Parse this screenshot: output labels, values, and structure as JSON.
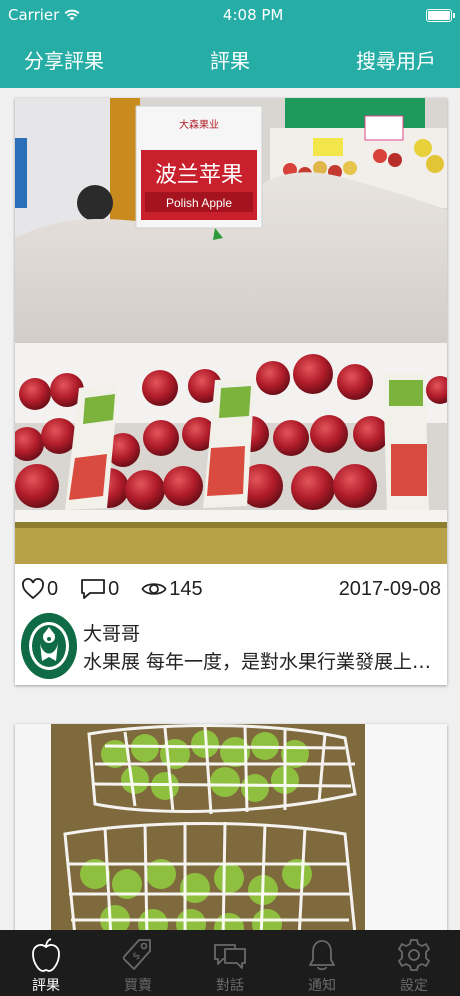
{
  "status_bar": {
    "carrier": "Carrier",
    "time": "4:08 PM"
  },
  "nav": {
    "left": "分享評果",
    "title": "評果",
    "right": "搜尋用戶"
  },
  "posts": [
    {
      "photo_icon": "apple-display-photo",
      "sign": {
        "title": "波兰苹果",
        "subtitle": "Polish Apple",
        "brand": "大森果业"
      },
      "likes": "0",
      "comments": "0",
      "views": "145",
      "date": "2017-09-08",
      "author": "大哥哥",
      "text": "水果展 每年一度，是對水果行業發展上…",
      "avatar_icon": "starbucks-logo-avatar"
    },
    {
      "photo_icon": "green-grapes-box-photo"
    }
  ],
  "tabs": [
    {
      "label": "評果",
      "icon": "apple-icon",
      "active": true
    },
    {
      "label": "買賣",
      "icon": "price-tag-icon",
      "active": false
    },
    {
      "label": "對話",
      "icon": "chat-icon",
      "active": false
    },
    {
      "label": "通知",
      "icon": "bell-icon",
      "active": false
    },
    {
      "label": "設定",
      "icon": "gear-icon",
      "active": false
    }
  ],
  "colors": {
    "accent": "#26ada5",
    "tabbar": "#1c1c1c",
    "tab_inactive": "#6a6a6a"
  }
}
